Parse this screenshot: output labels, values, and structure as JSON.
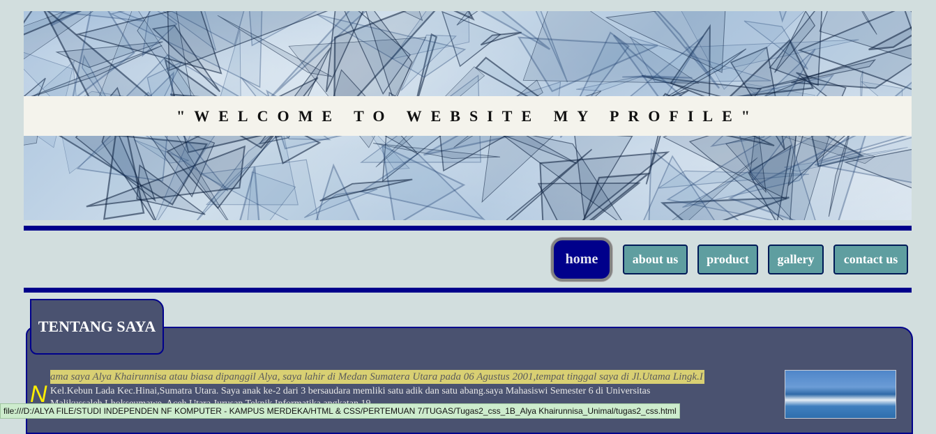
{
  "banner": {
    "title": "\"WELCOME TO WEBSITE MY PROFILE\""
  },
  "nav": {
    "items": [
      {
        "label": "home",
        "active": true
      },
      {
        "label": "about us"
      },
      {
        "label": "product"
      },
      {
        "label": "gallery"
      },
      {
        "label": "contact us"
      }
    ]
  },
  "section": {
    "heading": "TENTANG SAYA",
    "dropcap": "N",
    "line1": "ama saya Alya Khairunnisa atau biasa dipanggil Alya, saya lahir di Medan Sumatera Utara pada 06 Agustus 2001,tempat tinggal saya di Jl.Utama Lingk.I",
    "line2": "Kel.Kebun Lada Kec.Hinai,Sumatra Utara. Saya anak ke-2 dari 3 bersaudara memliki satu adik dan satu abang.saya Mahasiswi Semester 6 di Universitas",
    "line3": "Malikussaleh Lhokseumawe, Aceh Utara Jurusan Teknik Informatika angkatan 19"
  },
  "status_bar": {
    "url": "file:///D:/ALYA FILE/STUDI INDEPENDEN NF KOMPUTER - KAMPUS MERDEKA/HTML & CSS/PERTEMUAN 7/TUGAS/Tugas2_css_1B_Alya Khairunnisa_Unimal/tugas2_css.html"
  },
  "colors": {
    "page_bg": "#d2dede",
    "rule": "#00008b",
    "nav_btn": "#5f9ea0",
    "section_bg": "#4a5270",
    "highlight": "#d9d073"
  }
}
